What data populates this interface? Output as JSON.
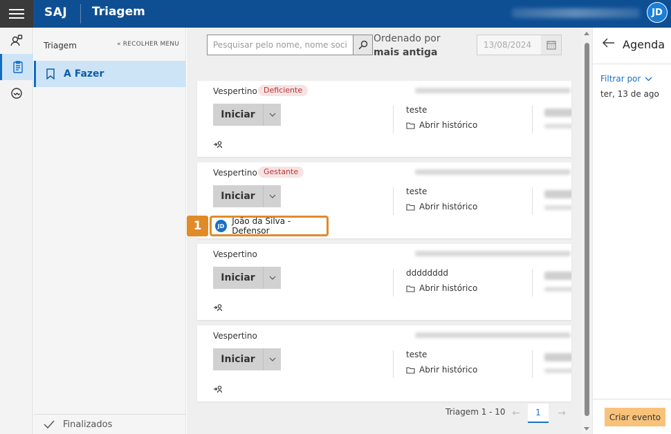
{
  "header": {
    "brand": "SAJ",
    "module": "Triagem",
    "avatar_initials": "JD",
    "colors": {
      "bar": "#0e4f94",
      "accent": "#e08a28"
    }
  },
  "rail": {
    "items": [
      {
        "icon": "user-assign-icon"
      },
      {
        "icon": "clipboard-list-icon",
        "active": true
      },
      {
        "icon": "handshake-icon"
      }
    ]
  },
  "sidebar": {
    "title": "Triagem",
    "collapse_label": "« RECOLHER MENU",
    "active_item": "A Fazer",
    "footer_item": "Finalizados"
  },
  "toolbar": {
    "search_placeholder": "Pesquisar pelo nome, nome social...",
    "sort_label": "Ordenado por",
    "sort_value": "mais antiga",
    "date_value": "13/08/2024"
  },
  "cards": [
    {
      "period": "Vespertino",
      "tag": "Deficiente",
      "button": "Iniciar",
      "note": "teste",
      "history": "Abrir histórico"
    },
    {
      "period": "Vespertino",
      "tag": "Gestante",
      "button": "Iniciar",
      "note": "teste",
      "history": "Abrir histórico",
      "assigned": "João da Silva - Defensor",
      "assigned_initials": "JD"
    },
    {
      "period": "Vespertino",
      "tag": "",
      "button": "Iniciar",
      "note": "dddddddd",
      "history": "Abrir histórico"
    },
    {
      "period": "Vespertino",
      "tag": "",
      "button": "Iniciar",
      "note": "teste",
      "history": "Abrir histórico"
    }
  ],
  "step_badge": "1",
  "pager": {
    "label": "Triagem 1 - 10",
    "current_page": "1",
    "prev": "←",
    "next": "→"
  },
  "agenda": {
    "back": "←",
    "title": "Agenda",
    "filter_label": "Filtrar por",
    "date": "ter, 13 de ago",
    "create_button": "Criar evento"
  }
}
